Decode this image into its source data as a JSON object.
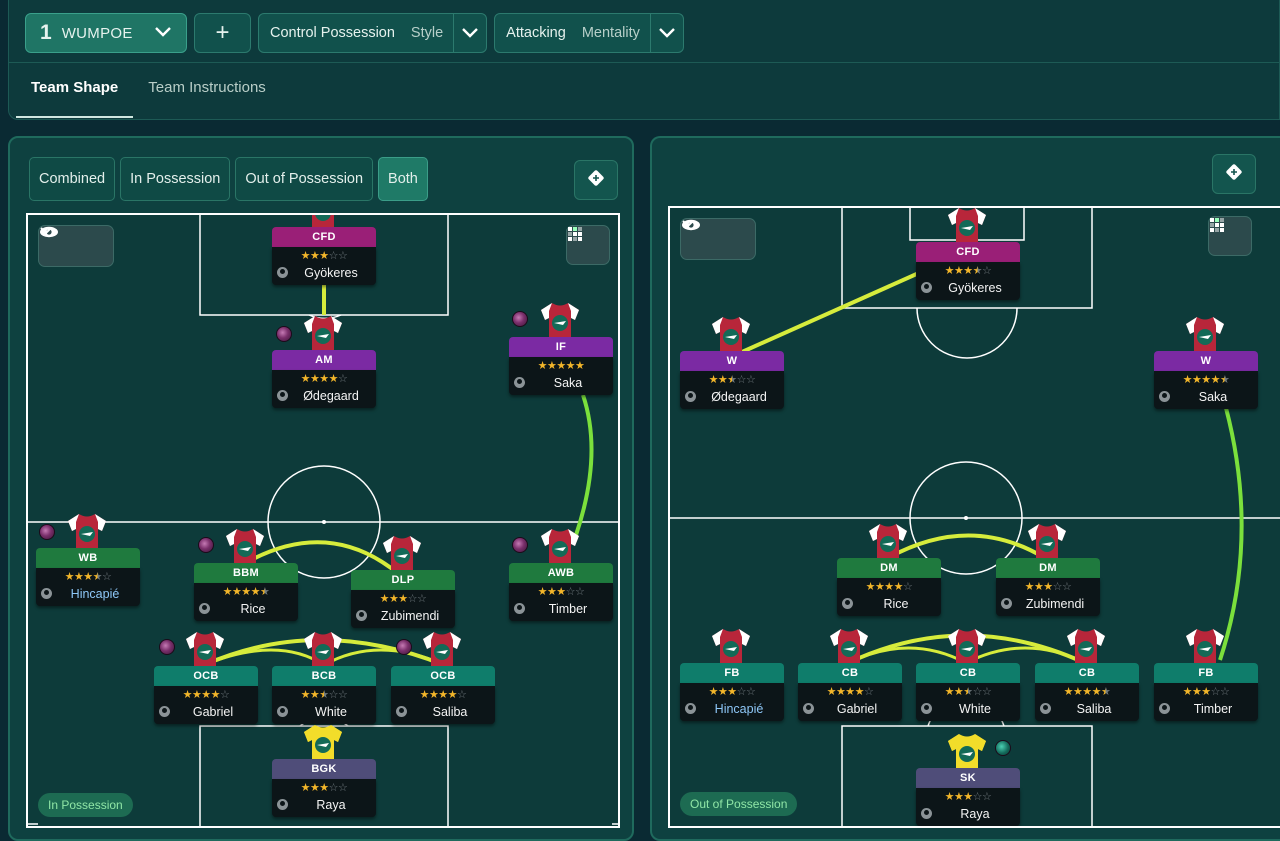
{
  "header": {
    "tactic_number": "1",
    "tactic_name": "WUMPOE",
    "plus_label": "+",
    "style_value": "Control Possession",
    "style_label": "Style",
    "mentality_value": "Attacking",
    "mentality_label": "Mentality"
  },
  "tabs": [
    {
      "label": "Team Shape",
      "active": true
    },
    {
      "label": "Team Instructions",
      "active": false
    }
  ],
  "view_modes": [
    {
      "label": "Combined",
      "active": false
    },
    {
      "label": "In Possession",
      "active": false
    },
    {
      "label": "Out of Possession",
      "active": false
    },
    {
      "label": "Both",
      "active": true
    }
  ],
  "left_pitch": {
    "phase_label": "In Possession",
    "players": [
      {
        "role": "CFD",
        "name": "Gyökeres",
        "stars": 3,
        "role_color": "r-att"
      },
      {
        "role": "AM",
        "name": "Ødegaard",
        "stars": 4,
        "role_color": "r-vio"
      },
      {
        "role": "IF",
        "name": "Saka",
        "stars": 5,
        "role_color": "r-vio"
      },
      {
        "role": "WB",
        "name": "Hincapié",
        "stars": 3.5,
        "role_color": "r-grn"
      },
      {
        "role": "BBM",
        "name": "Rice",
        "stars": 4.5,
        "role_color": "r-grn"
      },
      {
        "role": "DLP",
        "name": "Zubimendi",
        "stars": 3,
        "role_color": "r-grn"
      },
      {
        "role": "AWB",
        "name": "Timber",
        "stars": 3,
        "role_color": "r-grn"
      },
      {
        "role": "OCB",
        "name": "Gabriel",
        "stars": 4,
        "role_color": "r-tea"
      },
      {
        "role": "BCB",
        "name": "White",
        "stars": 2.5,
        "role_color": "r-tea"
      },
      {
        "role": "OCB",
        "name": "Saliba",
        "stars": 4,
        "role_color": "r-tea"
      },
      {
        "role": "BGK",
        "name": "Raya",
        "stars": 3,
        "role_color": "r-gk"
      }
    ]
  },
  "right_pitch": {
    "phase_label": "Out of Possession",
    "players": [
      {
        "role": "CFD",
        "name": "Gyökeres",
        "stars": 3.5,
        "role_color": "r-att"
      },
      {
        "role": "W",
        "name": "Ødegaard",
        "stars": 2.5,
        "role_color": "r-vio"
      },
      {
        "role": "W",
        "name": "Saka",
        "stars": 4.5,
        "role_color": "r-vio"
      },
      {
        "role": "DM",
        "name": "Rice",
        "stars": 4,
        "role_color": "r-grn"
      },
      {
        "role": "DM",
        "name": "Zubimendi",
        "stars": 3,
        "role_color": "r-grn"
      },
      {
        "role": "FB",
        "name": "Hincapié",
        "stars": 3,
        "role_color": "r-tea"
      },
      {
        "role": "CB",
        "name": "Gabriel",
        "stars": 4,
        "role_color": "r-tea"
      },
      {
        "role": "CB",
        "name": "White",
        "stars": 2.5,
        "role_color": "r-tea"
      },
      {
        "role": "CB",
        "name": "Saliba",
        "stars": 4.5,
        "role_color": "r-tea"
      },
      {
        "role": "FB",
        "name": "Timber",
        "stars": 3,
        "role_color": "r-tea"
      },
      {
        "role": "SK",
        "name": "Raya",
        "stars": 3,
        "role_color": "r-gk"
      }
    ]
  },
  "colors": {
    "link_line": "#c8e63a",
    "run_line": "#7be03c",
    "star_on": "#f3b62a",
    "star_off": "#727c80"
  }
}
